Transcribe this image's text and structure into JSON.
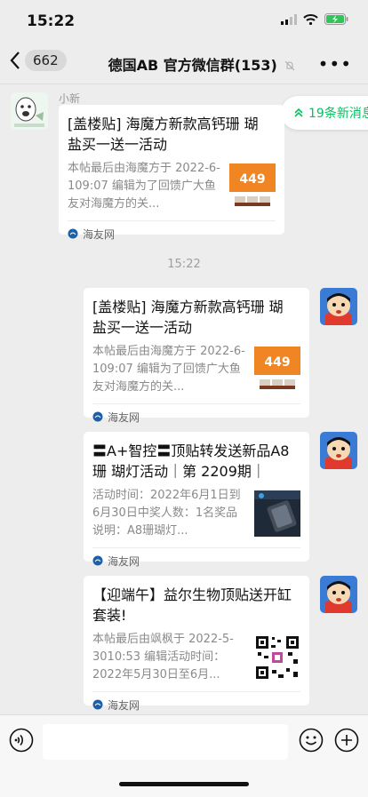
{
  "status_bar": {
    "time": "15:22",
    "icons": [
      "signal-icon",
      "wifi-icon",
      "battery-charging-icon"
    ]
  },
  "nav": {
    "unread_count": "662",
    "title": "德国AB  官方微信群(153)",
    "mute_icon": "bell-slash-icon",
    "more_icon": "ellipsis-icon",
    "back_icon": "chevron-left-icon"
  },
  "new_messages": {
    "label": "19条新消息",
    "icon": "double-chevron-up-icon"
  },
  "time_separator": "15:22",
  "messages": [
    {
      "sender": "小新",
      "title": "[盖楼贴] 海魔方新款高钙珊 瑚盐买一送一活动",
      "desc": "本帖最后由海魔方于 2022-6-109:07 编辑为了回馈广大鱼友对海魔方的关...",
      "source": "海友网"
    },
    {
      "title": "[盖楼贴] 海魔方新款高钙珊 瑚盐买一送一活动",
      "desc": "本帖最后由海魔方于 2022-6-109:07 编辑为了回馈广大鱼友对海魔方的关...",
      "source": "海友网"
    },
    {
      "title": "〓A+智控〓顶贴转发送新品A8珊 瑚灯活动｜第 2209期｜",
      "desc": "活动时间：2022年6月1日到6月30日中奖人数：1名奖品说明：A8珊瑚灯...",
      "source": "海友网"
    },
    {
      "title": "【迎端午】益尔生物顶贴送开缸套装!",
      "desc": "本帖最后由飒枫于 2022-5-3010:53 编辑活动时间：2022年5月30日至6月...",
      "source": "海友网"
    }
  ],
  "thumb_price": "449",
  "colors": {
    "accent": "#07c160",
    "orange": "#f08524",
    "background": "#ededed"
  }
}
